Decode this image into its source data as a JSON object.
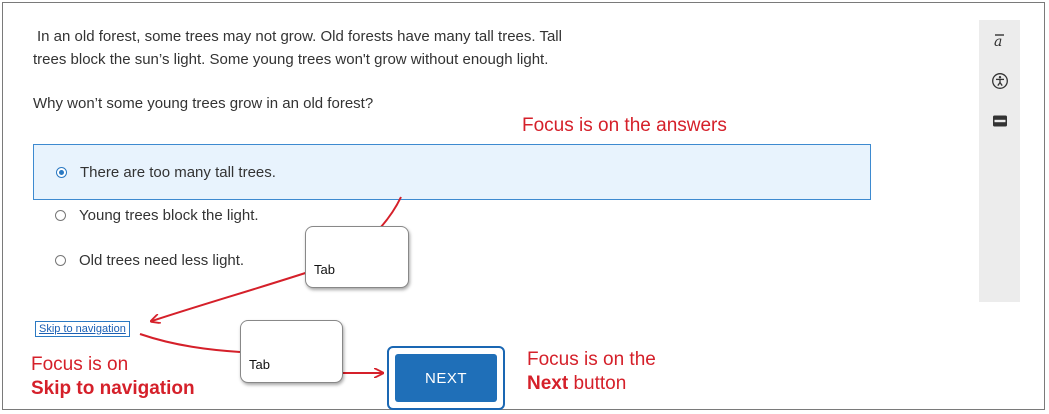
{
  "passage": {
    "line1": "In an old forest, some trees may not grow. Old forests have many tall trees. Tall",
    "line2": "trees block the sun’s light. Some young trees won't grow without enough light."
  },
  "question": "Why won’t some young trees grow in an old forest?",
  "choices": [
    {
      "label": "There are too many tall trees.",
      "selected": true
    },
    {
      "label": "Young trees block the light.",
      "selected": false
    },
    {
      "label": "Old trees need less light.",
      "selected": false
    }
  ],
  "sidebar": {
    "icons": [
      "text-to-speech-icon",
      "accessibility-icon",
      "line-reader-icon"
    ]
  },
  "annotations": {
    "focus_answers": "Focus is on the answers",
    "focus_skip_line1": "Focus is on",
    "focus_skip_line2": "Skip to navigation",
    "focus_next_line1": "Focus is on the",
    "focus_next_bold": "Next",
    "focus_next_rest": " button",
    "tab_key_1": "Tab",
    "tab_key_2": "Tab"
  },
  "skip_link": "Skip to navigation",
  "next_button": "NEXT",
  "colors": {
    "annotation_red": "#d5202a",
    "selected_bg": "#e8f3fd",
    "accent_blue": "#1f6fb8"
  }
}
